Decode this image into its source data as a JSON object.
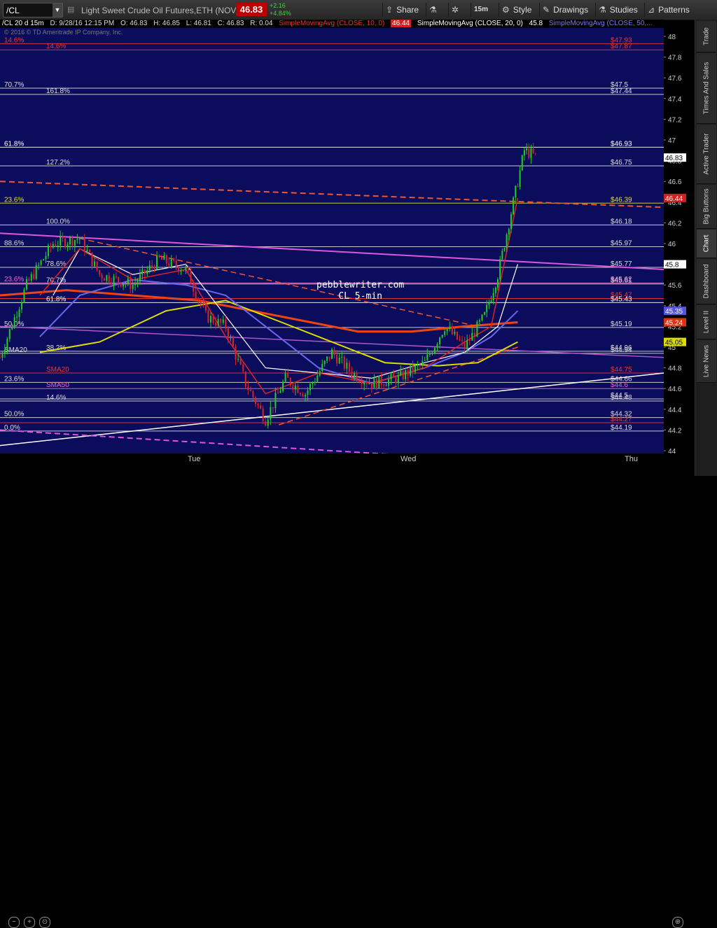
{
  "toolbar": {
    "symbol": "/CL",
    "description": "Light Sweet Crude Oil Futures,ETH (NOV 16)",
    "last_price": "46.83",
    "change": "+2.16",
    "change_pct": "+4.84%",
    "share": "Share",
    "timeframe": "15m",
    "style": "Style",
    "drawings": "Drawings",
    "studies": "Studies",
    "patterns": "Patterns"
  },
  "infobar": {
    "chart_id": "/CL 20 d 15m",
    "date": "D: 9/28/16 12:15 PM",
    "open": "O: 46.83",
    "high": "H: 46.85",
    "low": "L: 46.81",
    "close": "C: 46.83",
    "range": "R: 0.04",
    "sma1": "SimpleMovingAvg (CLOSE, 10, 0)",
    "sma1_val": "46.44",
    "sma2": "SimpleMovingAvg (CLOSE, 20, 0)",
    "sma2_val": "45.8",
    "sma3": "SimpleMovingAvg (CLOSE, 50,...",
    "copyright": "© 2016 © TD Ameritrade IP Company, Inc."
  },
  "watermark": {
    "line1": "pebblewriter.com",
    "line2": "CL 5-min"
  },
  "x_labels": [
    "Tue",
    "Wed",
    "Thu"
  ],
  "y_ticks": [
    "48",
    "47.8",
    "47.6",
    "47.4",
    "47.2",
    "47",
    "46.8",
    "46.6",
    "46.4",
    "46.2",
    "46",
    "45.8",
    "45.6",
    "45.4",
    "45.2",
    "45",
    "44.8",
    "44.6",
    "44.4",
    "44.2",
    "44"
  ],
  "y_badges": [
    {
      "v": 46.83,
      "text": "46.83",
      "bg": "#ffffff",
      "fg": "#000000"
    },
    {
      "v": 46.44,
      "text": "46.44",
      "bg": "#cc2222",
      "fg": "#ffffff"
    },
    {
      "v": 45.8,
      "text": "45.8",
      "bg": "#ffffff",
      "fg": "#000000"
    },
    {
      "v": 45.35,
      "text": "45.35",
      "bg": "#5555dd",
      "fg": "#ffffff"
    },
    {
      "v": 45.24,
      "text": "45.24",
      "bg": "#dd3311",
      "fg": "#ffffff"
    },
    {
      "v": 45.05,
      "text": "45.05",
      "bg": "#dddd00",
      "fg": "#000000"
    }
  ],
  "levels": [
    {
      "v": 47.93,
      "left": "14.6%",
      "right": "$47.93",
      "color": "#ee3333"
    },
    {
      "v": 47.87,
      "left": "14.6%",
      "right": "$47.87",
      "color": "#ee3333"
    },
    {
      "v": 47.5,
      "left": "70.7%",
      "right": "$47.5",
      "color": "#dddddd"
    },
    {
      "v": 47.44,
      "left": "161.8%",
      "right": "$47.44",
      "color": "#dddddd"
    },
    {
      "v": 46.93,
      "left": "61.8%",
      "right": "$46.93",
      "color": "#ffffff"
    },
    {
      "v": 46.75,
      "left": "127.2%",
      "right": "$46.75",
      "color": "#dddddd"
    },
    {
      "v": 46.39,
      "left": "23.6%",
      "right": "$46.39",
      "color": "#dddd44"
    },
    {
      "v": 46.18,
      "left": "100.0%",
      "right": "$46.18",
      "color": "#dddddd"
    },
    {
      "v": 45.97,
      "left": "88.6%",
      "right": "$45.97",
      "color": "#dddddd"
    },
    {
      "v": 45.77,
      "left": "78.6%",
      "right": "$45.77",
      "color": "#dddddd"
    },
    {
      "v": 45.62,
      "left": "23.6%",
      "right": "$45.62",
      "color": "#ee66cc"
    },
    {
      "v": 45.61,
      "left": "70.7%",
      "right": "$45.61",
      "color": "#dddddd"
    },
    {
      "v": 45.47,
      "left": "",
      "right": "$45.47",
      "color": "#ee3333"
    },
    {
      "v": 45.43,
      "left": "61.8%",
      "right": "$45.43",
      "color": "#ffffff"
    },
    {
      "v": 45.19,
      "left": "50.0%",
      "right": "$45.19",
      "color": "#dddddd"
    },
    {
      "v": 44.96,
      "left": "38.2%",
      "right": "$44.96",
      "color": "#dddddd"
    },
    {
      "v": 44.94,
      "left": "SMA20",
      "right": "$44.94",
      "color": "#dddddd"
    },
    {
      "v": 44.75,
      "left": "SMA20",
      "right": "$44.75",
      "color": "#ee3333"
    },
    {
      "v": 44.66,
      "left": "23.6%",
      "right": "$44.66",
      "color": "#dddddd"
    },
    {
      "v": 44.6,
      "left": "SMA50",
      "right": "$44.6",
      "color": "#ee66cc"
    },
    {
      "v": 44.5,
      "left": "",
      "right": "$44.5",
      "color": "#dddddd"
    },
    {
      "v": 44.48,
      "left": "14.6%",
      "right": "$44.48",
      "color": "#dddddd"
    },
    {
      "v": 44.32,
      "left": "50.0%",
      "right": "$44.32",
      "color": "#dddddd"
    },
    {
      "v": 44.27,
      "left": "",
      "right": "$44.27",
      "color": "#ee3333"
    },
    {
      "v": 44.19,
      "left": "0.0%",
      "right": "$44.19",
      "color": "#dddddd"
    }
  ],
  "side_tabs": [
    "Trade",
    "Times And Sales",
    "Active Trader",
    "Big Buttons",
    "Chart",
    "Dashboard",
    "Level II",
    "Live News"
  ],
  "chart_data": {
    "type": "candlestick",
    "title": "Light Sweet Crude Oil Futures,ETH (NOV 16)",
    "x_sessions": [
      "Tue",
      "Wed",
      "Thu"
    ],
    "ylim": [
      44.0,
      48.0
    ],
    "close_path": [
      [
        0,
        44.9
      ],
      [
        0.04,
        45.6
      ],
      [
        0.08,
        46.0
      ],
      [
        0.12,
        46.05
      ],
      [
        0.15,
        45.7
      ],
      [
        0.2,
        45.6
      ],
      [
        0.24,
        45.85
      ],
      [
        0.28,
        45.75
      ],
      [
        0.31,
        45.3
      ],
      [
        0.34,
        45.2
      ],
      [
        0.37,
        44.65
      ],
      [
        0.4,
        44.3
      ],
      [
        0.43,
        44.7
      ],
      [
        0.46,
        44.55
      ],
      [
        0.5,
        44.95
      ],
      [
        0.53,
        44.75
      ],
      [
        0.56,
        44.65
      ],
      [
        0.6,
        44.7
      ],
      [
        0.64,
        44.85
      ],
      [
        0.67,
        45.2
      ],
      [
        0.7,
        45.0
      ],
      [
        0.73,
        45.3
      ],
      [
        0.75,
        45.7
      ],
      [
        0.77,
        46.3
      ],
      [
        0.79,
        46.9
      ],
      [
        0.81,
        46.83
      ]
    ],
    "sma10": [
      [
        0.06,
        45.5
      ],
      [
        0.12,
        45.95
      ],
      [
        0.2,
        45.65
      ],
      [
        0.28,
        45.75
      ],
      [
        0.34,
        45.1
      ],
      [
        0.4,
        44.55
      ],
      [
        0.48,
        44.75
      ],
      [
        0.56,
        44.65
      ],
      [
        0.64,
        44.8
      ],
      [
        0.7,
        45.05
      ],
      [
        0.74,
        45.2
      ],
      [
        0.78,
        46.44
      ]
    ],
    "sma20": [
      [
        0.08,
        45.5
      ],
      [
        0.12,
        45.95
      ],
      [
        0.2,
        45.7
      ],
      [
        0.28,
        45.8
      ],
      [
        0.34,
        45.3
      ],
      [
        0.4,
        44.8
      ],
      [
        0.48,
        44.75
      ],
      [
        0.56,
        44.7
      ],
      [
        0.64,
        44.85
      ],
      [
        0.7,
        44.95
      ],
      [
        0.75,
        45.2
      ],
      [
        0.78,
        45.8
      ]
    ],
    "sma50": [
      [
        0.06,
        45.1
      ],
      [
        0.12,
        45.5
      ],
      [
        0.2,
        45.65
      ],
      [
        0.28,
        45.6
      ],
      [
        0.34,
        45.5
      ],
      [
        0.4,
        45.2
      ],
      [
        0.48,
        44.8
      ],
      [
        0.56,
        44.65
      ],
      [
        0.64,
        44.8
      ],
      [
        0.7,
        44.95
      ],
      [
        0.74,
        45.1
      ],
      [
        0.78,
        45.35
      ]
    ],
    "sma_yellow": [
      [
        0.06,
        44.95
      ],
      [
        0.15,
        45.05
      ],
      [
        0.25,
        45.35
      ],
      [
        0.34,
        45.45
      ],
      [
        0.42,
        45.25
      ],
      [
        0.5,
        45.05
      ],
      [
        0.58,
        44.85
      ],
      [
        0.66,
        44.82
      ],
      [
        0.72,
        44.85
      ],
      [
        0.78,
        45.05
      ]
    ],
    "sma_orange": [
      [
        0.0,
        45.5
      ],
      [
        0.1,
        45.55
      ],
      [
        0.2,
        45.5
      ],
      [
        0.3,
        45.45
      ],
      [
        0.38,
        45.35
      ],
      [
        0.46,
        45.25
      ],
      [
        0.54,
        45.15
      ],
      [
        0.62,
        45.15
      ],
      [
        0.7,
        45.2
      ],
      [
        0.78,
        45.24
      ]
    ]
  }
}
